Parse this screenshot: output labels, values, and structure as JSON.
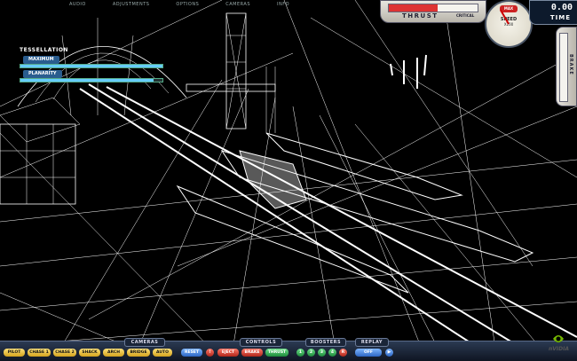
{
  "top_menu": [
    "AUDIO",
    "ADJUSTMENTS",
    "OPTIONS",
    "CAMERAS",
    "INFO"
  ],
  "tessellation": {
    "title": "TESSELLATION",
    "sliders": [
      {
        "label": "MAXIMUM",
        "value": 1.0
      },
      {
        "label": "PLANARITY",
        "value": 0.94
      }
    ]
  },
  "hud": {
    "thrust": {
      "label": "THRUST",
      "critical_label": "CRITICAL",
      "level": 0.55
    },
    "speedometer": {
      "label": "SPEED",
      "unit": "X100",
      "redline_label": "MAX"
    },
    "time": {
      "value": "0.00",
      "label": "TIME"
    },
    "brake": {
      "label": "BRAKE",
      "level": 0.0
    }
  },
  "bottom_bar": {
    "groups": {
      "cameras": "CAMERAS",
      "controls": "CONTROLS",
      "boosters": "BOOSTERS",
      "replay": "REPLAY"
    },
    "camera_buttons": [
      "PILOT",
      "CHASE 1",
      "CHASE 2",
      "SHACK",
      "ARCH",
      "BRIDGE",
      "AUTO"
    ],
    "control_buttons": [
      "RESET",
      "!",
      "EJECT",
      "BRAKE",
      "THRUST"
    ],
    "booster_buttons": [
      "1",
      "2",
      "3",
      "4",
      "R"
    ],
    "replay_buttons": [
      "OFF"
    ]
  },
  "logo": {
    "text": "nVIDIA"
  },
  "colors": {
    "wire": "#ffffff",
    "accent_blue": "#2c66c4",
    "accent_yellow": "#d4a21c",
    "alert_red": "#b0261a",
    "go_green": "#1c8a3a"
  }
}
